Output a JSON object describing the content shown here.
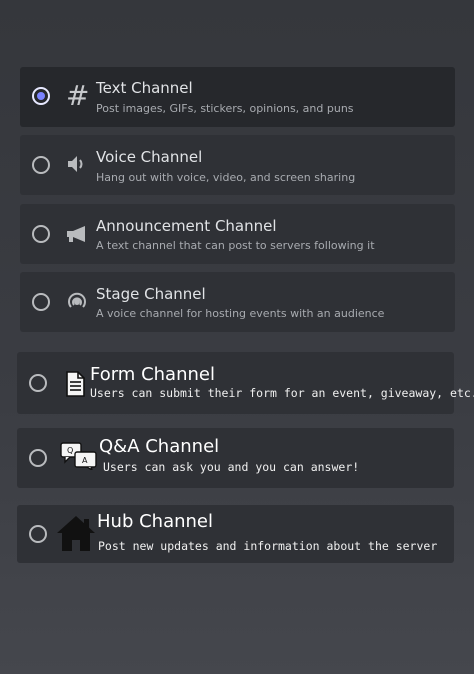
{
  "channels": [
    {
      "name": "Text Channel",
      "description": "Post images, GIFs, stickers, opinions, and puns",
      "icon": "hash-icon",
      "selected": true
    },
    {
      "name": "Voice Channel",
      "description": "Hang out with voice, video, and screen sharing",
      "icon": "speaker-icon",
      "selected": false
    },
    {
      "name": "Announcement Channel",
      "description": "A text channel that can post to servers following it",
      "icon": "megaphone-icon",
      "selected": false
    },
    {
      "name": "Stage Channel",
      "description": "A voice channel for hosting events with an audience",
      "icon": "stage-icon",
      "selected": false
    },
    {
      "name": "Form Channel",
      "description": "Users can submit their form for an event, giveaway, etc.",
      "icon": "document-icon",
      "selected": false
    },
    {
      "name": "Q&A Channel",
      "description": "Users can ask you and you can answer!",
      "icon": "chat-bubbles-icon",
      "selected": false
    },
    {
      "name": "Hub Channel",
      "description": "Post new updates and information about the server",
      "icon": "house-icon",
      "selected": false
    }
  ],
  "qa_icon_letters": {
    "q": "Q",
    "a": "A"
  },
  "colors": {
    "accent": "#7b83ff",
    "item_bg": "#2f3136",
    "selected_bg": "#26282c"
  }
}
